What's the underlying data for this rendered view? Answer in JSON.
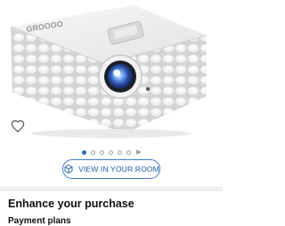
{
  "product": {
    "brand_on_device": "GROOOO",
    "image_alt": "White projector"
  },
  "gallery": {
    "image_count": 6,
    "active_index": 0,
    "has_video": true
  },
  "actions": {
    "view_in_room_label": "VIEW IN YOUR ROOM"
  },
  "sections": {
    "enhance_title": "Enhance your purchase",
    "payment_title": "Payment plans"
  },
  "colors": {
    "accent": "#1a73c9",
    "button_border": "#3a7bd5",
    "divider": "#eeeeee"
  }
}
